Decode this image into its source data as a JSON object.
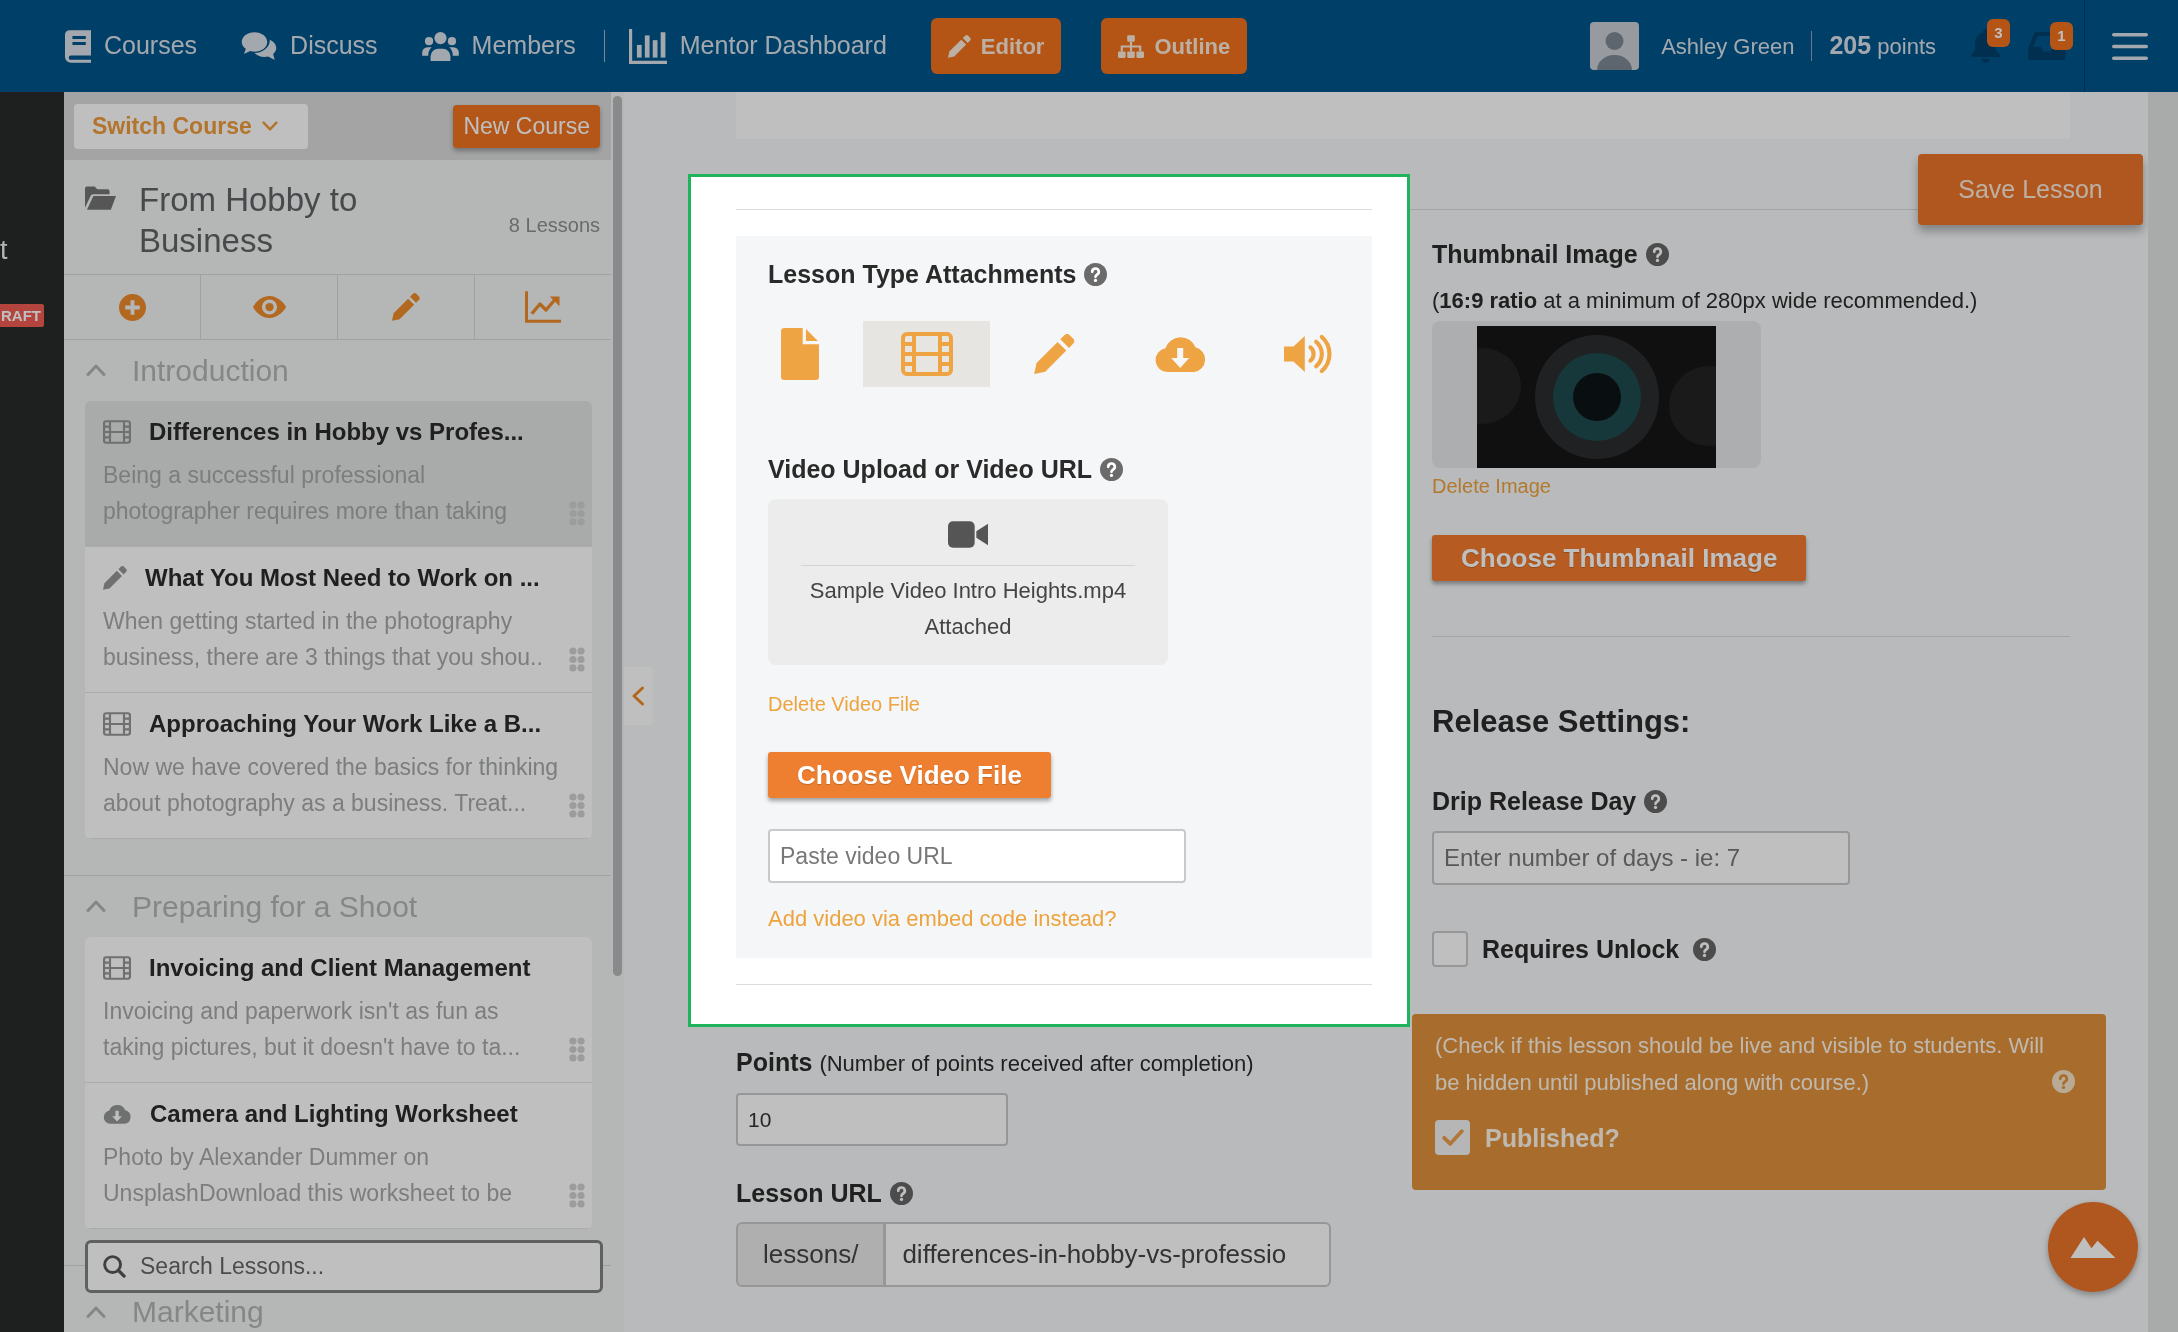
{
  "top_nav": {
    "links": [
      {
        "label": "Courses"
      },
      {
        "label": "Discuss"
      },
      {
        "label": "Members"
      },
      {
        "label": "Mentor Dashboard"
      }
    ],
    "mode_buttons": [
      {
        "label": "Editor"
      },
      {
        "label": "Outline"
      }
    ],
    "user": {
      "name": "Ashley Green",
      "points": "**205** points"
    },
    "alerts": [
      {
        "count": "3"
      },
      {
        "count": "1"
      }
    ]
  },
  "background_page": {
    "text": "t",
    "badge": "RAFT"
  },
  "sidebar": {
    "switch_course": "Switch Course",
    "new_course": "New Course",
    "course_title": "From Hobby to Business",
    "lesson_count": "8 Lessons",
    "sections": [
      {
        "title": "Introduction",
        "expanded": true,
        "lessons": [
          {
            "kind": "video",
            "title": "Differences in Hobby vs Profes...",
            "excerpt": "Being a successful professional\nphotographer requires more than taking",
            "selected": true
          },
          {
            "kind": "assignment",
            "title": "What You Most Need to Work on ...",
            "excerpt": "When getting started in the photography\nbusiness, there are 3 things that you shou..",
            "selected": false
          },
          {
            "kind": "video",
            "title": "Approaching Your Work Like a B...",
            "excerpt": "Now we have covered the basics for thinking\nabout photography as a business. Treat...",
            "selected": false
          }
        ]
      },
      {
        "title": "Preparing for a Shoot",
        "expanded": true,
        "lessons": [
          {
            "kind": "video",
            "title": "Invoicing and Client Management",
            "excerpt": "Invoicing and paperwork isn't as fun as\ntaking pictures, but it doesn't have to ta...",
            "selected": false
          },
          {
            "kind": "download",
            "title": "Camera and Lighting Worksheet",
            "excerpt": "Photo by Alexander Dummer on\nUnsplashDownload this worksheet to be",
            "selected": false
          }
        ]
      },
      {
        "title": "Marketing",
        "expanded": true
      }
    ],
    "search": {
      "placeholder": "Search Lessons..."
    }
  },
  "editor": {
    "save_button": "Save Lesson",
    "attachments": {
      "highlighted": true,
      "title": "Lesson Type Attachments",
      "help": true,
      "types": [
        {
          "kind": "document",
          "selected": false
        },
        {
          "kind": "video",
          "selected": true
        },
        {
          "kind": "assignment",
          "selected": false
        },
        {
          "kind": "download",
          "selected": false
        },
        {
          "kind": "audio",
          "selected": false
        }
      ],
      "video": {
        "title": "Video Upload or Video URL",
        "help": true,
        "file": "Sample Video Intro Heights.mp4\nAttached",
        "delete_link": "Delete Video File",
        "choose_button": "Choose Video File",
        "url_field": {
          "placeholder": "Paste video URL"
        },
        "embed_link": "Add video via embed code instead?"
      }
    },
    "points": {
      "label": "Points",
      "hint": "(Number of points received after completion)",
      "value": "10"
    },
    "lesson_url": {
      "label": "Lesson URL",
      "help": true,
      "prefix": "lessons/",
      "value": "differences-in-hobby-vs-professio"
    },
    "thumbnail": {
      "title": "Thumbnail Image",
      "help": true,
      "note": "(**16:9 ratio** at a minimum of 280px wide recommended.)",
      "delete_link": "Delete Image",
      "choose_button": "Choose Thumbnail Image"
    },
    "release": {
      "title": "Release Settings:",
      "drip_day": {
        "label": "Drip Release Day",
        "help": true,
        "placeholder": "Enter number of days - ie: 7"
      },
      "requires_unlock": {
        "label": "Requires Unlock",
        "help": true,
        "checked": false
      },
      "publish": {
        "note": "(Check if this lesson should be live and visible to students. Will\nbe hidden until published along with course.)",
        "help": true,
        "label": "Published?",
        "checked": true
      }
    }
  }
}
